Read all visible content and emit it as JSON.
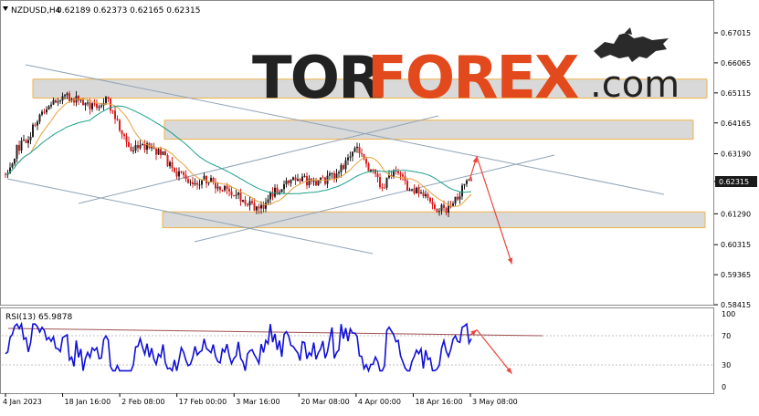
{
  "header": {
    "symbol_tf": "NZDUSD,H4",
    "ohlc": "0.62189 0.62373 0.62165 0.62315"
  },
  "logo": {
    "part1": "TOR",
    "part2": "FOREX",
    "part3": ".com"
  },
  "colors": {
    "bull": "#202020",
    "bear": "#d81e1e",
    "ma_fast": "#e6a13a",
    "ma_slow": "#1aa08a",
    "channel": "#8fa3b6",
    "zone_fill": "#d9d9d9",
    "zone_border": "#f0b24a",
    "forecast": "#e8463b",
    "rsi_line": "#1010d8",
    "rsi_res": "#a05050"
  },
  "chart_data": [
    {
      "type": "candlestick",
      "series": [
        {
          "name": "NZDUSD,H4",
          "close_path": [
            [
              "4 Jan 2023",
              0.6255
            ],
            [
              "7 Jan 2023",
              0.6335
            ],
            [
              "10 Jan 2023",
              0.637
            ],
            [
              "13 Jan 2023",
              0.645
            ],
            [
              "16 Jan 2023",
              0.648
            ],
            [
              "18 Jan 2023",
              0.65
            ],
            [
              "22 Jan 2023",
              0.649
            ],
            [
              "26 Jan 2023",
              0.647
            ],
            [
              "30 Jan 2023",
              0.649
            ],
            [
              "2 Feb 2023",
              0.641
            ],
            [
              "5 Feb 2023",
              0.633
            ],
            [
              "9 Feb 2023",
              0.634
            ],
            [
              "13 Feb 2023",
              0.632
            ],
            [
              "17 Feb 2023",
              0.6255
            ],
            [
              "21 Feb 2023",
              0.623
            ],
            [
              "25 Feb 2023",
              0.624
            ],
            [
              "28 Feb 2023",
              0.6205
            ],
            [
              "3 Mar 2023",
              0.62
            ],
            [
              "7 Mar 2023",
              0.616
            ],
            [
              "10 Mar 2023",
              0.614
            ],
            [
              "14 Mar 2023",
              0.62
            ],
            [
              "18 Mar 2023",
              0.623
            ],
            [
              "20 Mar 2023",
              0.625
            ],
            [
              "24 Mar 2023",
              0.622
            ],
            [
              "28 Mar 2023",
              0.624
            ],
            [
              "31 Mar 2023",
              0.627
            ],
            [
              "4 Apr 2023",
              0.634
            ],
            [
              "7 Apr 2023",
              0.628
            ],
            [
              "11 Apr 2023",
              0.621
            ],
            [
              "14 Apr 2023",
              0.628
            ],
            [
              "17 Apr 2023",
              0.621
            ],
            [
              "20 Apr 2023",
              0.62
            ],
            [
              "24 Apr 2023",
              0.615
            ],
            [
              "27 Apr 2023",
              0.614
            ],
            [
              "30 Apr 2023",
              0.618
            ],
            [
              "2 May 2023",
              0.6232
            ]
          ]
        },
        {
          "name": "MA fast"
        },
        {
          "name": "MA slow"
        }
      ],
      "y_ticks": [
        "0.67015",
        "0.66065",
        "0.65115",
        "0.64165",
        "0.63190",
        "0.62315",
        "0.61290",
        "0.60315",
        "0.59365",
        "0.58415"
      ],
      "last_price": "0.62315",
      "ylim": [
        0.5835,
        0.672
      ],
      "x_ticks": [
        "4 Jan 2023",
        "18 Jan 16:00",
        "2 Feb 08:00",
        "17 Feb 00:00",
        "3 Mar 16:00",
        "20 Mar 08:00",
        "4 Apr 00:00",
        "18 Apr 16:00",
        "3 May 08:00"
      ],
      "resistance_zones": [
        [
          0.6495,
          0.6555
        ],
        [
          0.6365,
          0.6425
        ]
      ],
      "support_zones": [
        [
          0.6085,
          0.6135
        ]
      ],
      "forecast_path": [
        [
          "3 May 2023",
          0.6232
        ],
        [
          "5 May 2023",
          0.631
        ],
        [
          "14 May 2023",
          0.597
        ]
      ],
      "grid": false,
      "legend": "none"
    },
    {
      "type": "line",
      "title": "RSI(13) 65.9878",
      "y_ticks": [
        "100",
        "70",
        "30",
        "0"
      ],
      "ylim": [
        0,
        100
      ],
      "levels": [
        70,
        30
      ],
      "resistance_line": [
        [
          9,
          80
        ],
        [
          594,
          70
        ]
      ],
      "forecast_path": [
        [
          "3 May 2023",
          70
        ],
        [
          "5 May 2023",
          78
        ],
        [
          "14 May 2023",
          18
        ]
      ],
      "rsi_last": 65.99
    }
  ]
}
